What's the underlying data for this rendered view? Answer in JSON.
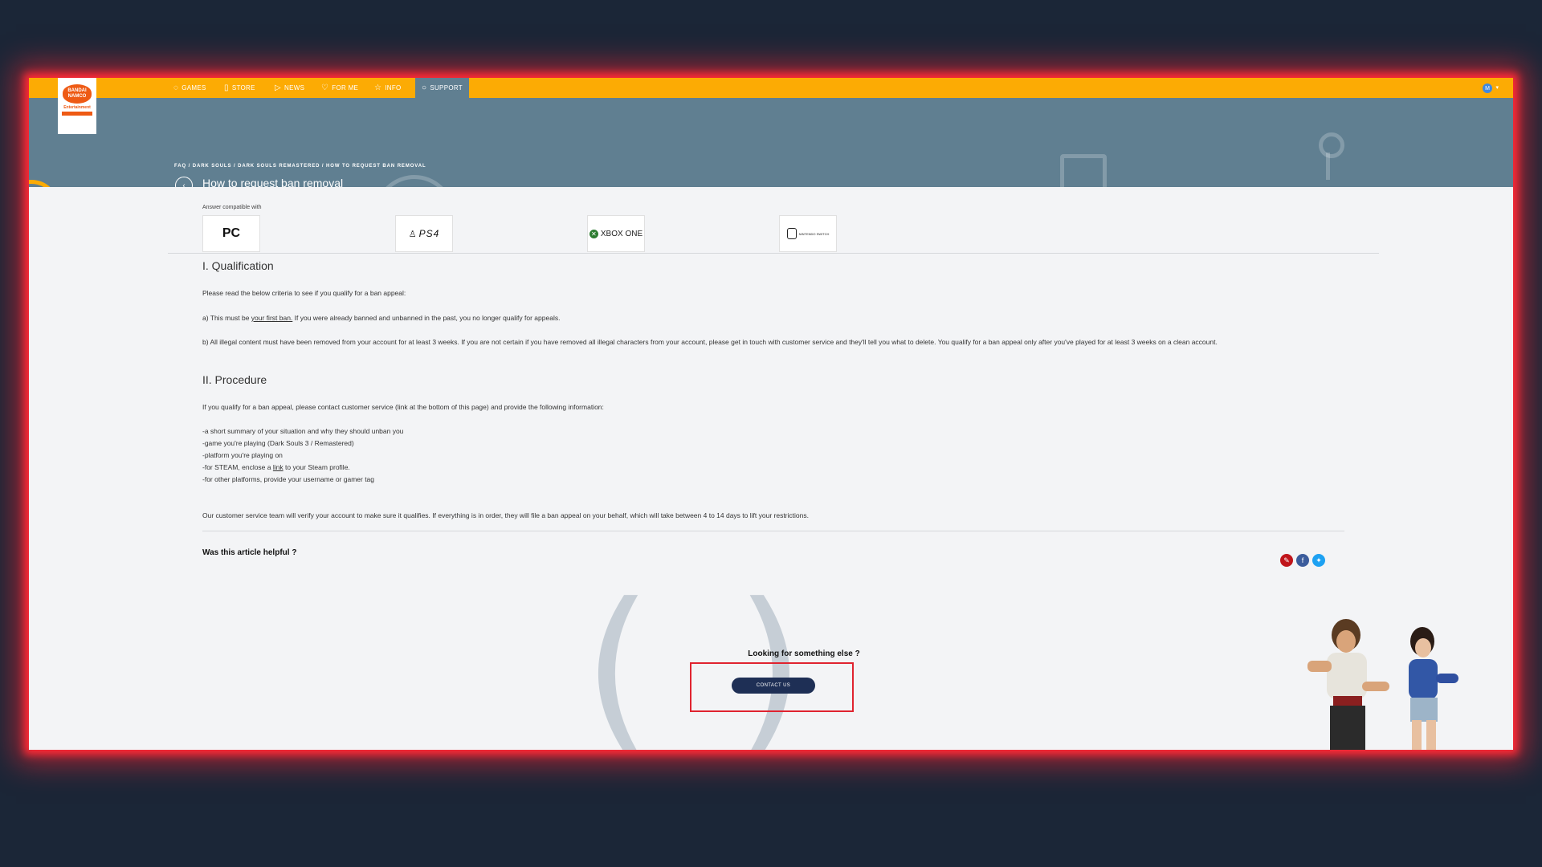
{
  "nav": {
    "items": [
      {
        "icon": "◌",
        "label": "GAMES"
      },
      {
        "icon": "▯",
        "label": "STORE"
      },
      {
        "icon": "▷",
        "label": "NEWS"
      },
      {
        "icon": "♡",
        "label": "FOR ME"
      },
      {
        "icon": "☆",
        "label": "INFO"
      },
      {
        "icon": "○",
        "label": "SUPPORT"
      }
    ],
    "avatar_initial": "M"
  },
  "logo": {
    "line1": "BANDAI",
    "line2": "NAMCO",
    "sub": "Entertainment"
  },
  "header": {
    "breadcrumb": "FAQ / DARK SOULS / DARK SOULS REMASTERED / HOW TO REQUEST BAN REMOVAL",
    "title": "How to request ban removal"
  },
  "compat": {
    "label": "Answer compatible with",
    "platforms": [
      "PC",
      "PS4",
      "XBOX ONE",
      "NINTENDO SWITCH"
    ]
  },
  "article": {
    "s1_title": "I. Qualification",
    "s1_intro": "Please read the below criteria to see if you qualify for a ban appeal:",
    "s1_a_pre": "a) This must be ",
    "s1_a_link": "your first ban.",
    "s1_a_post": " If you were already banned and unbanned in the past, you no longer qualify for appeals.",
    "s1_b": "b) All illegal content must have been removed from your account for at least 3 weeks. If you are not certain if you have removed all illegal characters from your account, please get in touch with customer service and they'll tell you what to delete. You qualify for a ban appeal only after you've played for at least 3 weeks on a clean account.",
    "s2_title": "II. Procedure",
    "s2_intro": "If you qualify for a ban appeal, please contact customer service (link at the bottom of this page) and provide the following information:",
    "s2_l1": "-a short summary of your situation and why they should unban you",
    "s2_l2": "-game you're playing (Dark Souls 3 / Remastered)",
    "s2_l3": "-platform you're playing on",
    "s2_l4_pre": "-for STEAM, enclose a ",
    "s2_l4_link": "link",
    "s2_l4_post": " to your Steam profile.",
    "s2_l5": "-for other platforms, provide your username or gamer tag",
    "s2_outro": "Our customer service team will verify your account to make sure it qualifies. If everything is in order, they will file a ban appeal on your behalf, which will take between 4 to 14 days to lift your restrictions."
  },
  "feedback": {
    "helpful": "Was this article helpful ?"
  },
  "footer": {
    "looking": "Looking for something else ?",
    "contact": "CONTACT US"
  },
  "colors": {
    "nav_bg": "#fcab04",
    "header_bg": "#607f91",
    "highlight": "#e0232f",
    "button": "#1e2f55"
  }
}
